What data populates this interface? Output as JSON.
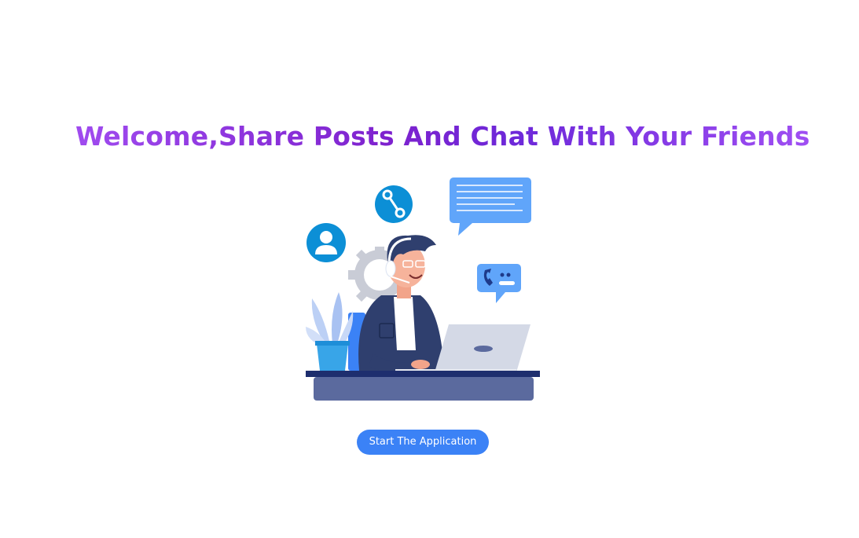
{
  "hero": {
    "title": "Welcome,Share Posts And Chat With Your Friends",
    "illustration_icons": [
      "user-icon",
      "wrench-icon",
      "chat-bubble-icon",
      "phone-bubble-icon",
      "gear-icon",
      "plant-icon",
      "laptop-icon"
    ]
  },
  "actions": {
    "start_label": "Start The Application"
  },
  "colors": {
    "title_gradient_start": "#a855f7",
    "title_gradient_mid": "#6d28d9",
    "button_bg": "#3b82f6",
    "icon_blue": "#0c8fd6",
    "bubble_blue": "#60a5fa",
    "desk": "#5b6a9e",
    "jacket": "#2f3f6e"
  }
}
